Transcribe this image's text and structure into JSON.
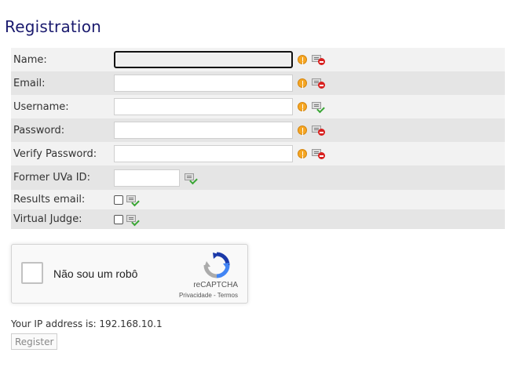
{
  "page": {
    "title": "Registration"
  },
  "form": {
    "fields": [
      {
        "label": "Name:",
        "value": ""
      },
      {
        "label": "Email:",
        "value": ""
      },
      {
        "label": "Username:",
        "value": ""
      },
      {
        "label": "Password:",
        "value": ""
      },
      {
        "label": "Verify Password:",
        "value": ""
      },
      {
        "label": "Former UVa ID:",
        "value": ""
      },
      {
        "label": "Results email:",
        "checked": false
      },
      {
        "label": "Virtual Judge:",
        "checked": false
      }
    ],
    "status_icons": [
      "warning-icon",
      "invalid-doc-icon",
      "valid-doc-icon"
    ]
  },
  "recaptcha": {
    "checkbox_label": "Não sou um robô",
    "brand": "reCAPTCHA",
    "privacy_link": "Privacidade",
    "separator": "-",
    "terms_link": "Termos"
  },
  "ip": {
    "text": "Your IP address is: 192.168.10.1"
  },
  "register_button": {
    "label": "Register"
  },
  "colors": {
    "title": "#1a1a6e",
    "row_light": "#f2f2f2",
    "row_dark": "#e5e5e5",
    "warning": "#f5a623",
    "invalid": "#d8201f",
    "valid": "#3aa635"
  }
}
